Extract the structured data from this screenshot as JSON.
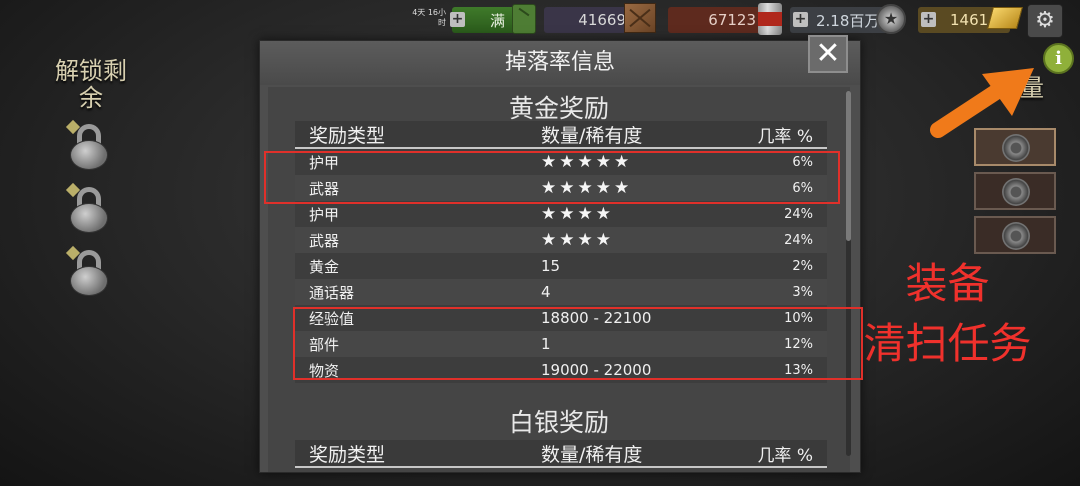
{
  "topbar": {
    "timer": "4天 16小时",
    "energy": "满",
    "wood": "41669",
    "food": "67123",
    "money": "2.18百万",
    "gold": "1461"
  },
  "icons": {
    "plus": "+",
    "gear": "⚙",
    "info": "i",
    "close": "✕"
  },
  "left": {
    "unlock_title": "解锁剩余"
  },
  "right": {
    "partial_title": "子量"
  },
  "dialog": {
    "title": "掉落率信息",
    "gold_section": {
      "heading": "黄金奖励",
      "headers": {
        "type": "奖励类型",
        "qty": "数量/稀有度",
        "rate": "几率 %"
      },
      "rows": [
        {
          "type": "护甲",
          "qty": "★★★★★",
          "rate": "6%"
        },
        {
          "type": "武器",
          "qty": "★★★★★",
          "rate": "6%"
        },
        {
          "type": "护甲",
          "qty": "★★★★",
          "rate": "24%"
        },
        {
          "type": "武器",
          "qty": "★★★★",
          "rate": "24%"
        },
        {
          "type": "黄金",
          "qty": "15",
          "rate": "2%"
        },
        {
          "type": "通话器",
          "qty": "4",
          "rate": "3%"
        },
        {
          "type": "经验值",
          "qty": "18800 - 22100",
          "rate": "10%"
        },
        {
          "type": "部件",
          "qty": "1",
          "rate": "12%"
        },
        {
          "type": "物资",
          "qty": "19000 - 22000",
          "rate": "13%"
        }
      ]
    },
    "silver_section": {
      "heading": "白银奖励",
      "headers": {
        "type": "奖励类型",
        "qty": "数量/稀有度",
        "rate": "几率 %"
      }
    }
  },
  "annotations": {
    "line1": "装备",
    "line2": "清扫任务",
    "color": "#f0312c",
    "arrow_color": "#f07a1a"
  }
}
